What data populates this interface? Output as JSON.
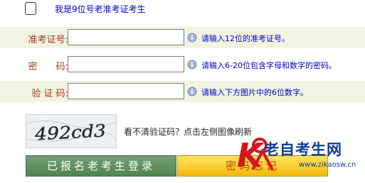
{
  "old_candidate": {
    "label": "我是9位号老准考证考生",
    "checked": false
  },
  "fields": [
    {
      "label": "准考证号:",
      "value": "",
      "hint": "请输入12位的准考证号。"
    },
    {
      "label": "密　　码:",
      "value": "",
      "hint": "请输入6-20位包含字母和数字的密码。"
    },
    {
      "label": "验 证 码:",
      "value": "",
      "hint": "请输入下方图片中的6位数字。"
    }
  ],
  "captcha": {
    "image_text": "492cd3",
    "refresh_text": "看不清验证码？点击左侧图像刷新"
  },
  "buttons": {
    "registered": "已报名老考生登录",
    "forgot": "密码忘记"
  },
  "watermark": {
    "brand": "老自考生网",
    "url": "www.zikaosw.cn",
    "mark": "K"
  },
  "colors": {
    "label": "#a33a1a",
    "hint": "#0000cc",
    "band": "#f3f3e1",
    "green_button": "#5a8b5c",
    "yellow_button": "#f7c81e",
    "logo": "#0c3d9c"
  }
}
